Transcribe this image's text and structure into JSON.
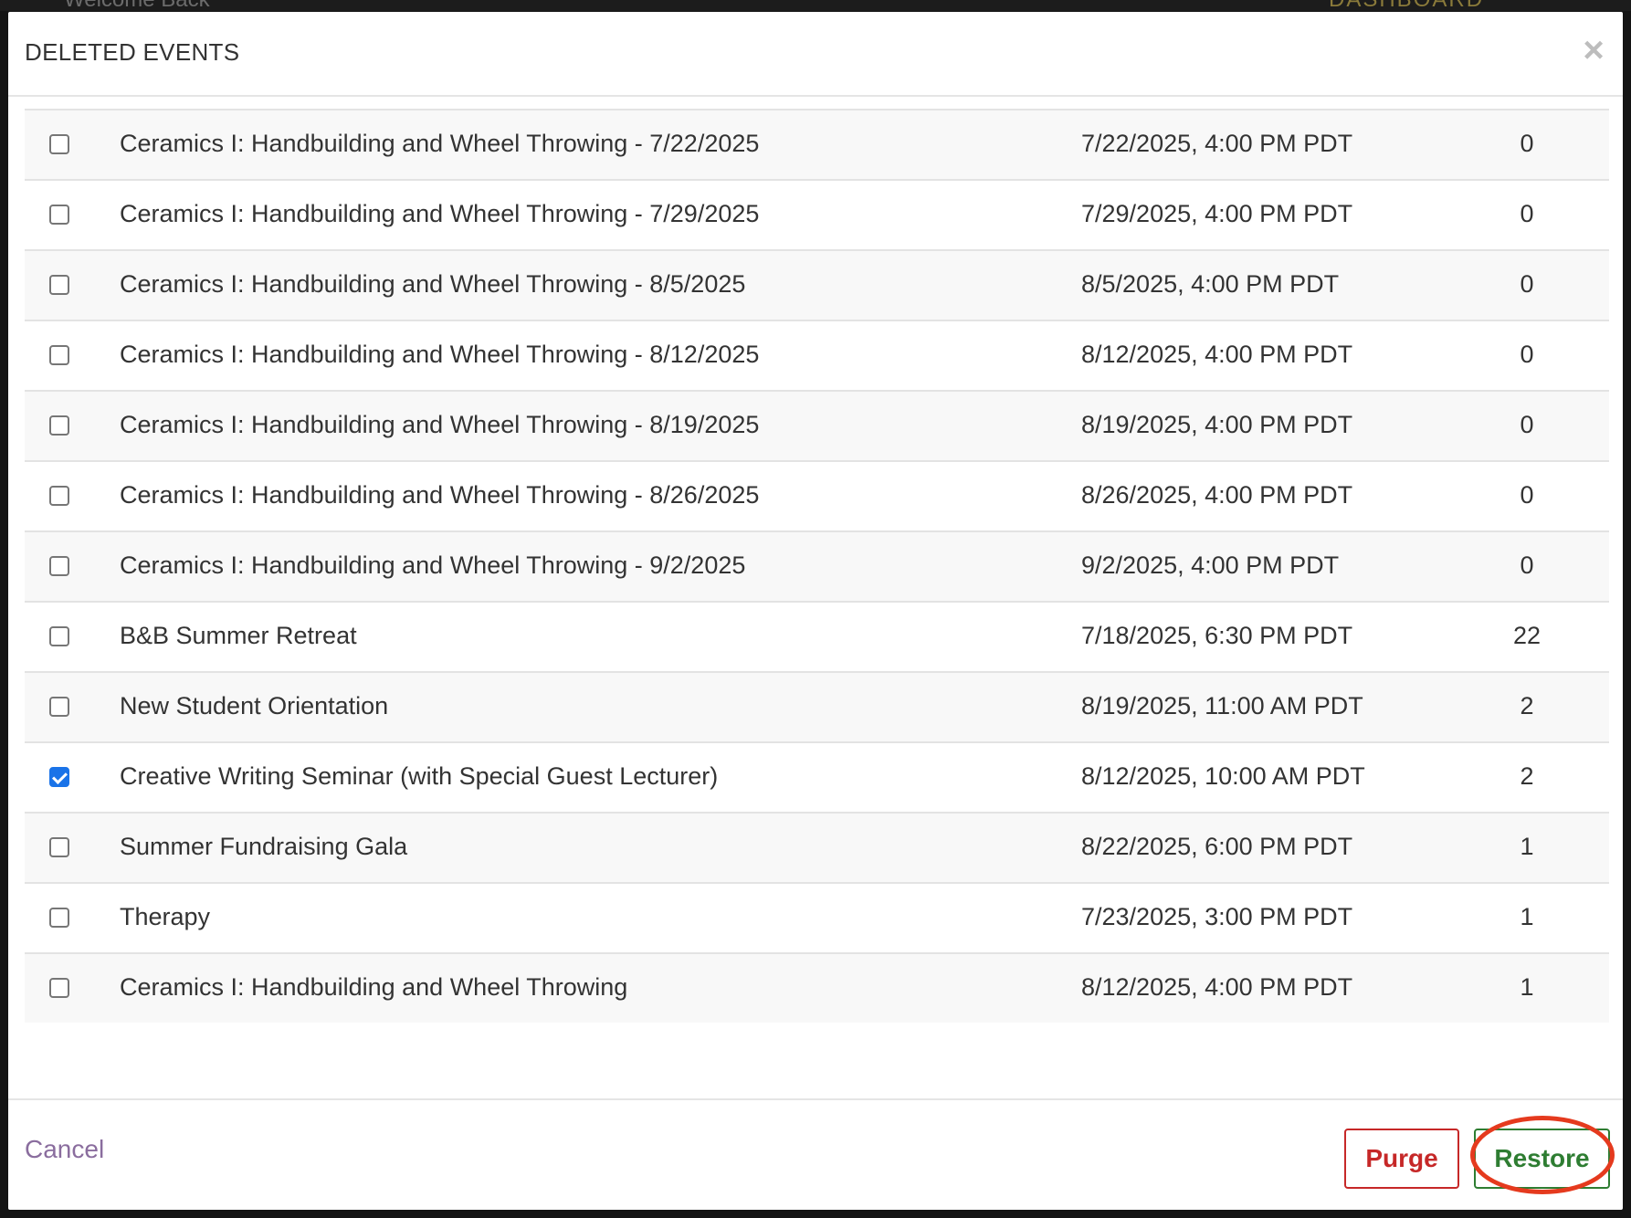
{
  "modal": {
    "title": "DELETED EVENTS",
    "close_label": "×"
  },
  "background": {
    "left_text": "Welcome Back",
    "right_text": "DASHBOARD"
  },
  "events": [
    {
      "name": "Ceramics I: Handbuilding and Wheel Throwing - 7/22/2025",
      "date": "7/22/2025, 4:00 PM PDT",
      "count": "0",
      "checked": false
    },
    {
      "name": "Ceramics I: Handbuilding and Wheel Throwing - 7/29/2025",
      "date": "7/29/2025, 4:00 PM PDT",
      "count": "0",
      "checked": false
    },
    {
      "name": "Ceramics I: Handbuilding and Wheel Throwing - 8/5/2025",
      "date": "8/5/2025, 4:00 PM PDT",
      "count": "0",
      "checked": false
    },
    {
      "name": "Ceramics I: Handbuilding and Wheel Throwing - 8/12/2025",
      "date": "8/12/2025, 4:00 PM PDT",
      "count": "0",
      "checked": false
    },
    {
      "name": "Ceramics I: Handbuilding and Wheel Throwing - 8/19/2025",
      "date": "8/19/2025, 4:00 PM PDT",
      "count": "0",
      "checked": false
    },
    {
      "name": "Ceramics I: Handbuilding and Wheel Throwing - 8/26/2025",
      "date": "8/26/2025, 4:00 PM PDT",
      "count": "0",
      "checked": false
    },
    {
      "name": "Ceramics I: Handbuilding and Wheel Throwing - 9/2/2025",
      "date": "9/2/2025, 4:00 PM PDT",
      "count": "0",
      "checked": false
    },
    {
      "name": "B&B Summer Retreat",
      "date": "7/18/2025, 6:30 PM PDT",
      "count": "22",
      "checked": false
    },
    {
      "name": "New Student Orientation",
      "date": "8/19/2025, 11:00 AM PDT",
      "count": "2",
      "checked": false
    },
    {
      "name": "Creative Writing Seminar (with Special Guest Lecturer)",
      "date": "8/12/2025, 10:00 AM PDT",
      "count": "2",
      "checked": true
    },
    {
      "name": "Summer Fundraising Gala",
      "date": "8/22/2025, 6:00 PM PDT",
      "count": "1",
      "checked": false
    },
    {
      "name": "Therapy",
      "date": "7/23/2025, 3:00 PM PDT",
      "count": "1",
      "checked": false
    },
    {
      "name": "Ceramics I: Handbuilding and Wheel Throwing",
      "date": "8/12/2025, 4:00 PM PDT",
      "count": "1",
      "checked": false
    }
  ],
  "footer": {
    "cancel_label": "Cancel",
    "purge_label": "Purge",
    "restore_label": "Restore"
  },
  "colors": {
    "purge": "#c62828",
    "restore": "#2e7d32",
    "cancel": "#8a6d9e",
    "checkbox_checked": "#1a73e8",
    "annotation_ring": "#e53a1e"
  }
}
